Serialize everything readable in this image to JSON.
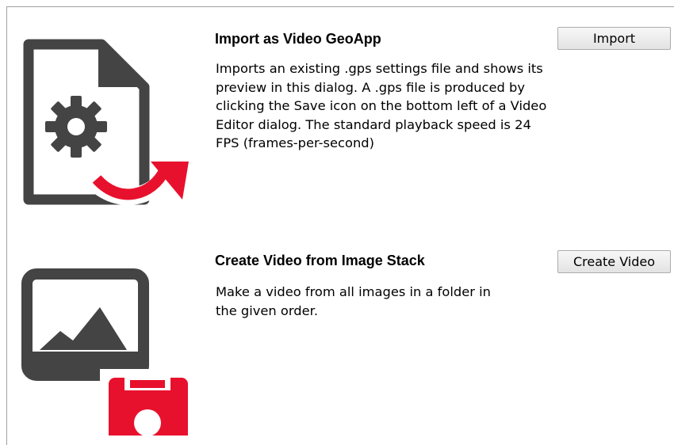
{
  "items": [
    {
      "title": "Import as Video GeoApp",
      "description": "Imports an existing .gps settings file and shows its preview in this dialog. A .gps file is produced by clicking the Save icon on the bottom left of a Video Editor dialog. The standard playback speed is 24 FPS (frames-per-second)",
      "button_label": "Import",
      "icon": "settings-file-import-icon"
    },
    {
      "title": "Create Video from Image Stack",
      "description": "Make a video from all images in a folder in the given order.",
      "button_label": "Create Video",
      "icon": "image-save-icon"
    }
  ],
  "colors": {
    "icon_gray": "#444444",
    "accent_red": "#e8112d"
  }
}
